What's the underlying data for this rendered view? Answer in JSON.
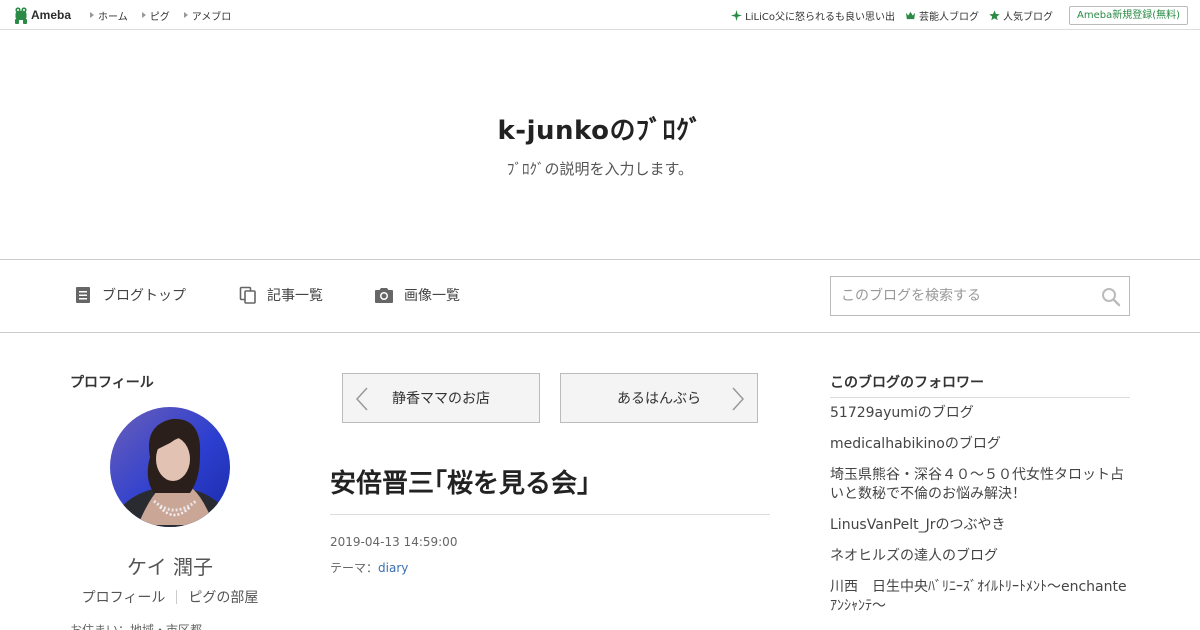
{
  "topbar": {
    "logo_text": "Ameba",
    "nav": [
      "ホーム",
      "ピグ",
      "アメブロ"
    ],
    "right_links": [
      {
        "icon": "sparkle-icon",
        "label": "LiLiCo父に怒られるも良い思い出"
      },
      {
        "icon": "crown-icon",
        "label": "芸能人ブログ"
      },
      {
        "icon": "star-icon",
        "label": "人気ブログ"
      }
    ],
    "signup_label": "Ameba新規登録(無料)"
  },
  "header": {
    "title": "k-junkoのﾌﾞﾛｸﾞ",
    "description": "ﾌﾞﾛｸﾞの説明を入力します。"
  },
  "nav": {
    "items": [
      {
        "icon": "document-icon",
        "label": "ブログトップ"
      },
      {
        "icon": "copy-icon",
        "label": "記事一覧"
      },
      {
        "icon": "camera-icon",
        "label": "画像一覧"
      }
    ],
    "search_placeholder": "このブログを検索する"
  },
  "profile": {
    "heading": "プロフィール",
    "name": "ケイ 潤子",
    "links": [
      "プロフィール",
      "ピグの部屋"
    ],
    "cut_text": "お住まい：地域・市区都"
  },
  "entry": {
    "prev_label": "静香ママのお店",
    "next_label": "あるはんぶら",
    "title": "安倍晋三｢桜を見る会｣",
    "date": "2019-04-13 14:59:00",
    "theme_prefix": "テーマ：",
    "theme": "diary"
  },
  "followers": {
    "heading": "このブログのフォロワー",
    "items": [
      "51729ayumiのブログ",
      "medicalhabikinoのブログ",
      "埼玉県熊谷・深谷４０～５０代女性タロット占いと数秘で不倫のお悩み解決！",
      "LinusVanPelt_Jrのつぶやき",
      "ネオヒルズの達人のブログ",
      "川西　日生中央ﾊﾞﾘﾆｰｽﾞｵｲﾙﾄﾘｰﾄﾒﾝﾄ〜enchanteｱﾝｼｬﾝﾃ〜"
    ]
  },
  "colors": {
    "brand_green": "#2a8a46",
    "link_blue": "#3a6fb0"
  }
}
